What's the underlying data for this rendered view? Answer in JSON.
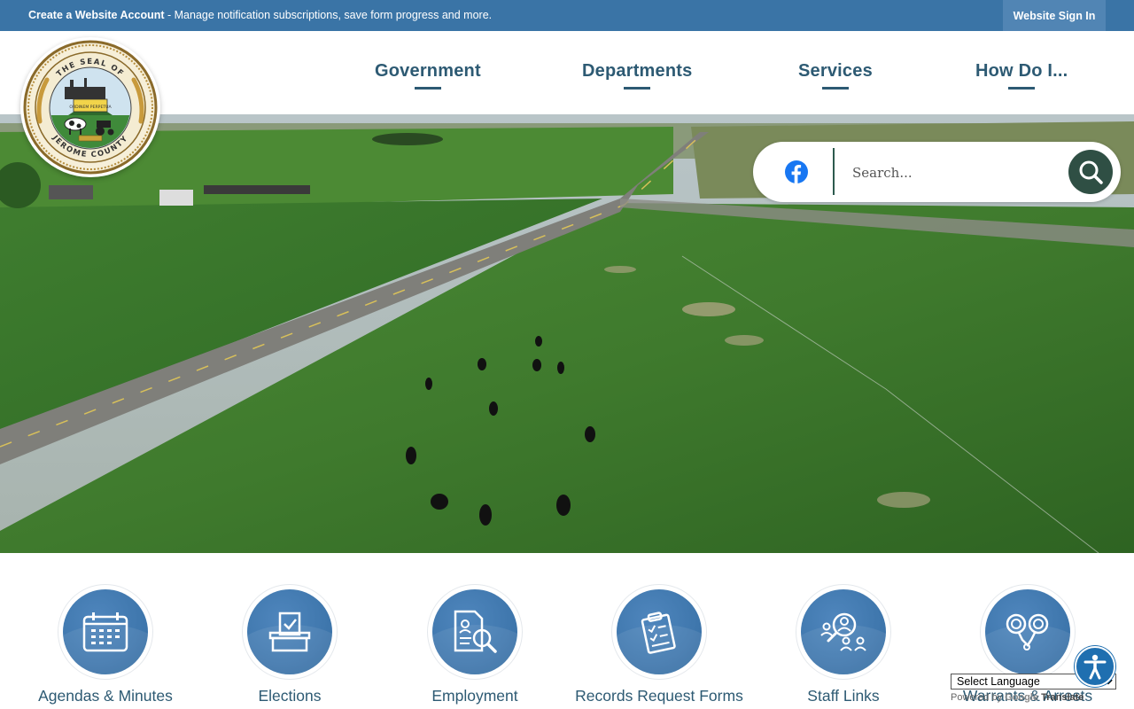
{
  "topbar": {
    "account_link": "Create a Website Account",
    "account_desc": " - Manage notification subscriptions, save form progress and more.",
    "signin_label": "Website Sign In"
  },
  "seal": {
    "top_text": "THE SEAL OF",
    "bottom_text": "JEROME COUNTY",
    "motto": "ORDINEM PERPETUA"
  },
  "nav": {
    "items": [
      {
        "label": "Government"
      },
      {
        "label": "Departments"
      },
      {
        "label": "Services"
      },
      {
        "label": "How Do I..."
      }
    ]
  },
  "search": {
    "placeholder": "Search...",
    "social_icon": "facebook-icon",
    "button_icon": "search-icon"
  },
  "quick_links": [
    {
      "label": "Agendas & Minutes",
      "icon": "calendar-icon"
    },
    {
      "label": "Elections",
      "icon": "ballot-box-icon"
    },
    {
      "label": "Employment",
      "icon": "document-search-icon"
    },
    {
      "label": "Records Request Forms",
      "icon": "clipboard-form-icon"
    },
    {
      "label": "Staff Links",
      "icon": "people-search-icon"
    },
    {
      "label": "Warrants & Arrests",
      "icon": "handcuffs-icon"
    }
  ],
  "translate": {
    "select_label": "Select Language",
    "powered_by": "Powered by",
    "google": "Google",
    "translate_word": "Translate"
  },
  "colors": {
    "topbar": "#3a74a6",
    "nav_text": "#2d5a73",
    "search_button": "#2f4f44",
    "quick_link_circle": "#3f77ad",
    "accessibility": "#1f6fb0"
  }
}
